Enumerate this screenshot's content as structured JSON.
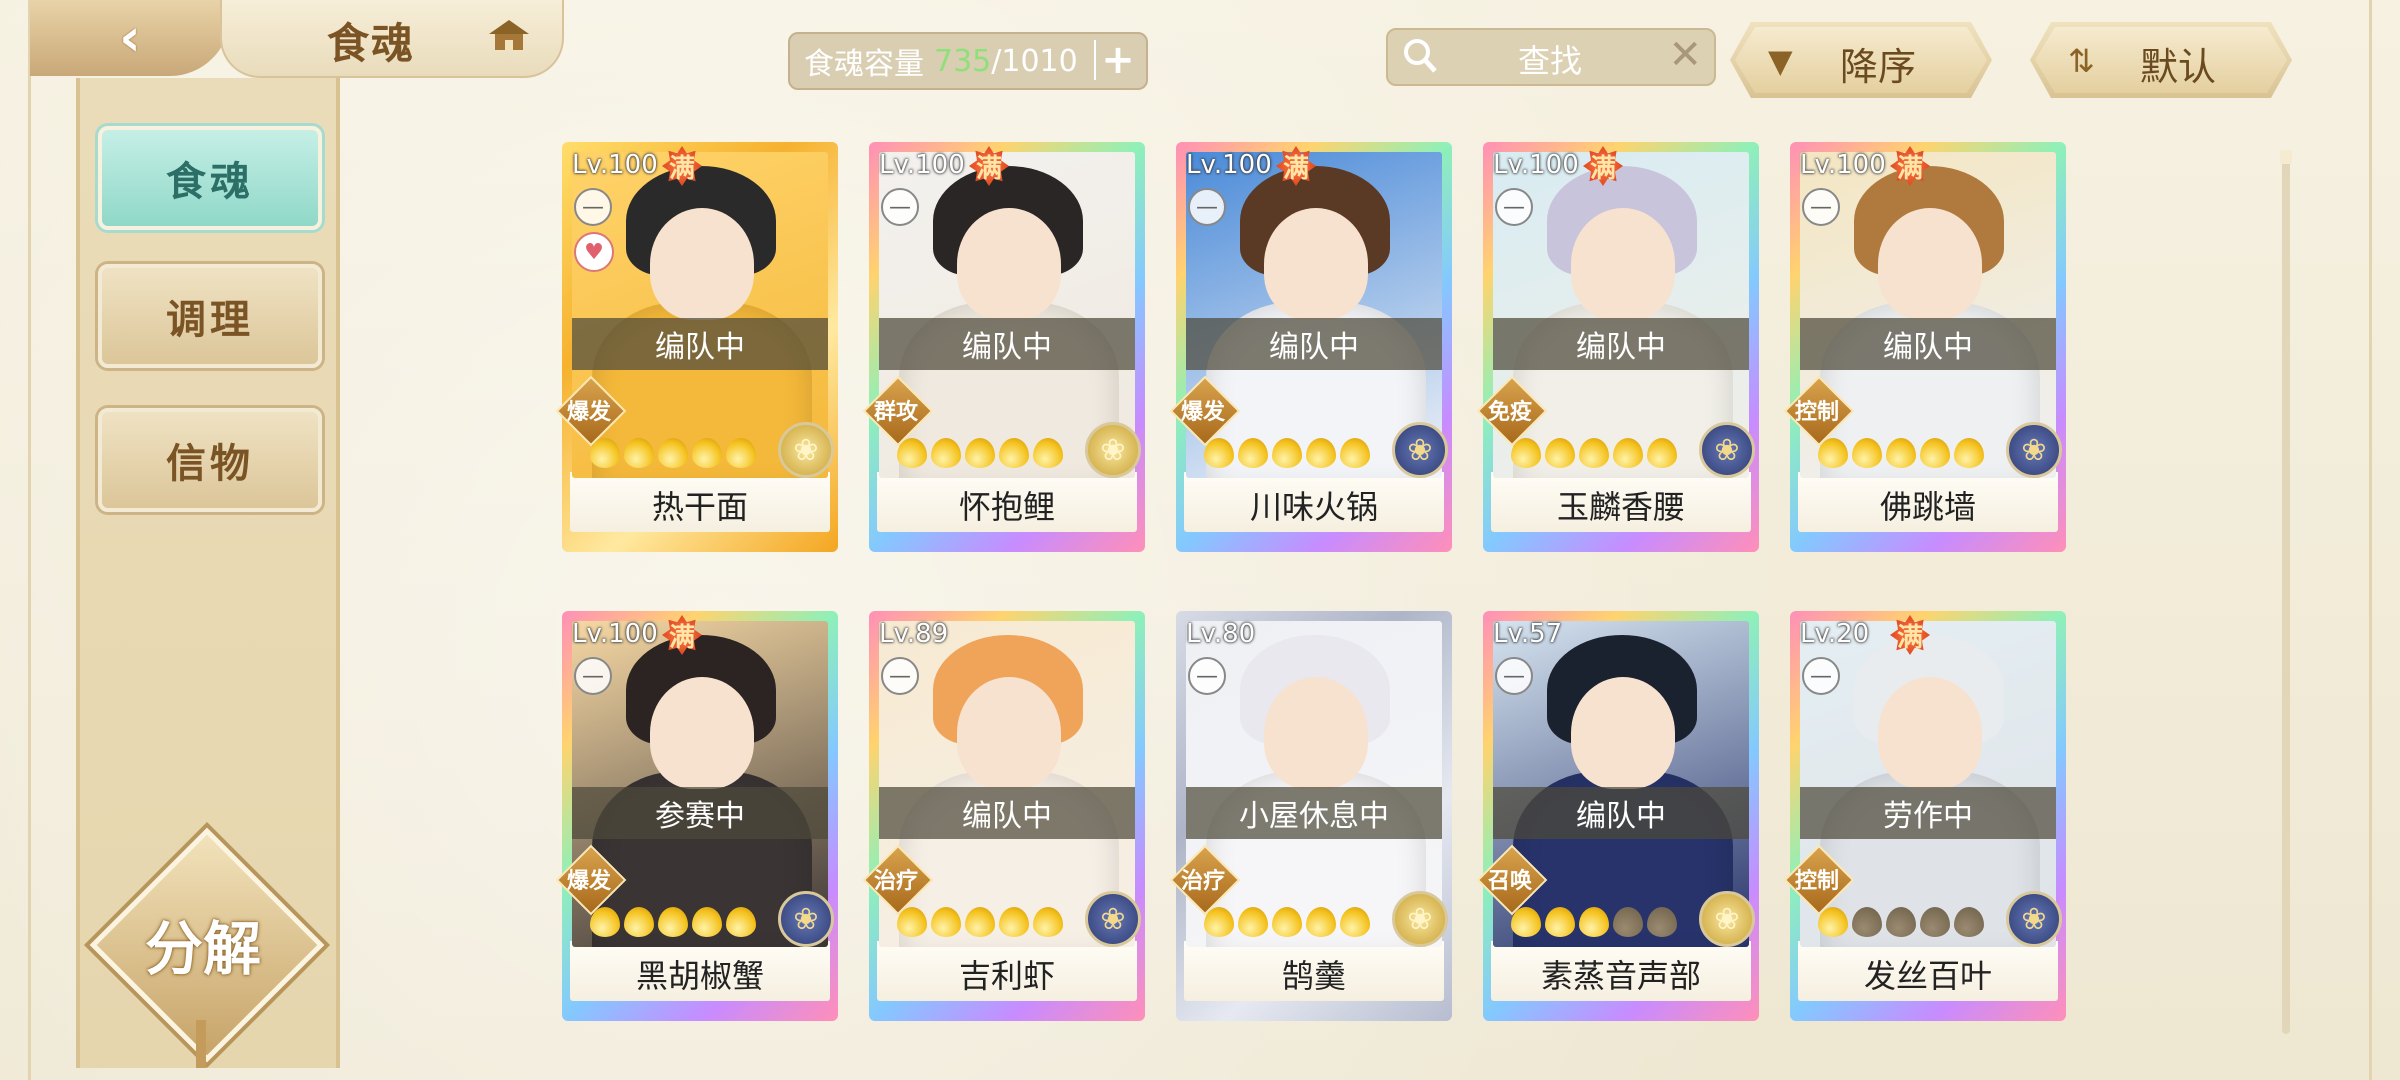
{
  "header": {
    "title": "食魂",
    "capacity_label": "食魂容量",
    "capacity_current": "735",
    "capacity_max": "/1010",
    "search_placeholder": "查找",
    "sort_order_label": "降序",
    "sort_mode_label": "默认"
  },
  "sidebar": {
    "tabs": [
      {
        "label": "食魂",
        "active": true
      },
      {
        "label": "调理",
        "active": false
      },
      {
        "label": "信物",
        "active": false
      }
    ],
    "decompose_label": "分解"
  },
  "colors": {
    "capacity_current": "#8fe07a",
    "active_tab": "#8fd8c8",
    "full_badge": "#d2361c"
  },
  "cards": [
    {
      "level": "Lv.100",
      "full": "满",
      "status": "编队中",
      "role": "爆发",
      "stars_on": 5,
      "emblem": "gold",
      "name": "热干面",
      "frame": "goldcard",
      "fav": true,
      "palette": [
        "#ffd36a",
        "#2a2a2a",
        "#f4b83a"
      ]
    },
    {
      "level": "Lv.100",
      "full": "满",
      "status": "编队中",
      "role": "群攻",
      "stars_on": 5,
      "emblem": "gold",
      "name": "怀抱鲤",
      "frame": "rainbow",
      "fav": false,
      "palette": [
        "#f3f1ee",
        "#2b2626",
        "#efe9df"
      ]
    },
    {
      "level": "Lv.100",
      "full": "满",
      "status": "编队中",
      "role": "爆发",
      "stars_on": 5,
      "emblem": "blue",
      "name": "川味火锅",
      "frame": "rainbow",
      "fav": false,
      "palette": [
        "#4a8ad8",
        "#5a3a24",
        "#f2f4f8"
      ]
    },
    {
      "level": "Lv.100",
      "full": "满",
      "status": "编队中",
      "role": "免疫",
      "stars_on": 5,
      "emblem": "blue",
      "name": "玉麟香腰",
      "frame": "rainbow",
      "fav": false,
      "palette": [
        "#d8ecf2",
        "#c8c4dc",
        "#f1efe8"
      ]
    },
    {
      "level": "Lv.100",
      "full": "满",
      "status": "编队中",
      "role": "控制",
      "stars_on": 5,
      "emblem": "blue",
      "name": "佛跳墙",
      "frame": "rainbow",
      "fav": false,
      "palette": [
        "#f4e6c2",
        "#b07a3e",
        "#eef0f2"
      ]
    },
    {
      "level": "Lv.100",
      "full": "满",
      "status": "参赛中",
      "role": "爆发",
      "stars_on": 5,
      "emblem": "blue",
      "name": "黑胡椒蟹",
      "frame": "rainbow",
      "fav": false,
      "palette": [
        "#f6d8a4",
        "#2c2422",
        "#3a3434"
      ]
    },
    {
      "level": "Lv.89",
      "full": "",
      "status": "编队中",
      "role": "治疗",
      "stars_on": 5,
      "emblem": "blue",
      "name": "吉利虾",
      "frame": "rainbow",
      "fav": false,
      "palette": [
        "#f7ead2",
        "#f0a45a",
        "#f6efe6"
      ]
    },
    {
      "level": "Lv.80",
      "full": "",
      "status": "小屋休息中",
      "role": "治疗",
      "stars_on": 5,
      "emblem": "gold",
      "name": "鹄羹",
      "frame": "silvercard",
      "fav": false,
      "palette": [
        "#eef0f4",
        "#e8e8ee",
        "#f6f6f8"
      ]
    },
    {
      "level": "Lv.57",
      "full": "",
      "status": "编队中",
      "role": "召唤",
      "stars_on": 3,
      "emblem": "gold",
      "name": "素蒸音声部",
      "frame": "rainbow",
      "fav": false,
      "palette": [
        "#d6e4f0",
        "#1a2230",
        "#27336a"
      ]
    },
    {
      "level": "Lv.20",
      "full": "满",
      "status": "劳作中",
      "role": "控制",
      "stars_on": 1,
      "emblem": "blue",
      "name": "发丝百叶",
      "frame": "rainbow",
      "fav": false,
      "palette": [
        "#e4eef2",
        "#e8ecee",
        "#dfe3e8"
      ]
    }
  ]
}
